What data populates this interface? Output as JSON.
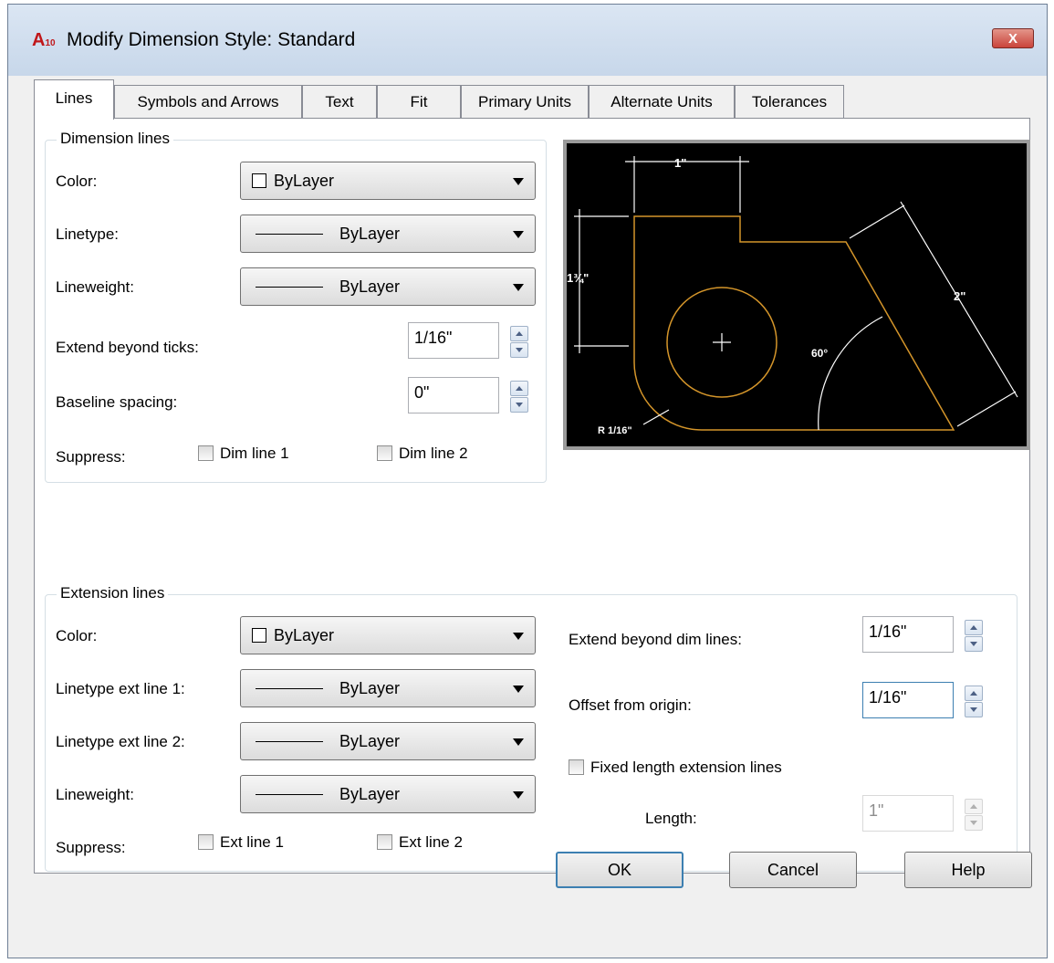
{
  "window": {
    "title": "Modify Dimension Style: Standard",
    "icon": "autocad-icon",
    "close_label": "X"
  },
  "tabs": [
    "Lines",
    "Symbols and Arrows",
    "Text",
    "Fit",
    "Primary Units",
    "Alternate Units",
    "Tolerances"
  ],
  "active_tab": "Lines",
  "dimension_lines": {
    "title": "Dimension lines",
    "color_label": "Color:",
    "color_value": "ByLayer",
    "linetype_label": "Linetype:",
    "linetype_value": "ByLayer",
    "lineweight_label": "Lineweight:",
    "lineweight_value": "ByLayer",
    "extend_label": "Extend beyond ticks:",
    "extend_value": "1/16\"",
    "baseline_label": "Baseline spacing:",
    "baseline_value": "0\"",
    "suppress_label": "Suppress:",
    "dim_line_1": "Dim line 1",
    "dim_line_2": "Dim line 2"
  },
  "preview": {
    "dim_top": "1\"",
    "dim_left": "1¾\"",
    "dim_right": "2\"",
    "dim_angle": "60°",
    "dim_radius": "R 1/16\""
  },
  "extension_lines": {
    "title": "Extension lines",
    "color_label": "Color:",
    "color_value": "ByLayer",
    "lt1_label": "Linetype ext line 1:",
    "lt1_value": "ByLayer",
    "lt2_label": "Linetype ext line 2:",
    "lt2_value": "ByLayer",
    "lineweight_label": "Lineweight:",
    "lineweight_value": "ByLayer",
    "suppress_label": "Suppress:",
    "ext_line_1": "Ext line 1",
    "ext_line_2": "Ext line 2",
    "extend_dim_label": "Extend beyond dim lines:",
    "extend_dim_value": "1/16\"",
    "offset_label": "Offset from origin:",
    "offset_value": "1/16\"",
    "fixed_label": "Fixed length extension lines",
    "length_label": "Length:",
    "length_value": "1\""
  },
  "buttons": {
    "ok": "OK",
    "cancel": "Cancel",
    "help": "Help"
  }
}
